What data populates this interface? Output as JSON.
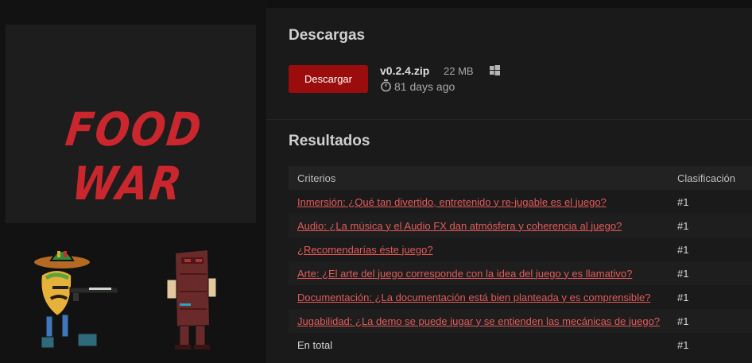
{
  "cover": {
    "title": "FOOD WAR"
  },
  "downloads": {
    "heading": "Descargas",
    "button_label": "Descargar",
    "file": {
      "name": "v0.2.4.zip",
      "size": "22 MB",
      "platform_icon": "windows-icon",
      "age": "81 days ago"
    }
  },
  "results": {
    "heading": "Resultados",
    "columns": [
      "Criterios",
      "Clasificación"
    ],
    "rows": [
      {
        "criterion": "Inmersión: ¿Qué tan divertido, entretenido y re-jugable es el juego?",
        "rank": "#1"
      },
      {
        "criterion": "Audio: ¿La música y el Audio FX dan atmósfera y coherencia al juego?",
        "rank": "#1"
      },
      {
        "criterion": "¿Recomendarías éste juego?",
        "rank": "#1"
      },
      {
        "criterion": "Arte: ¿El arte del juego corresponde con la idea del juego y es llamativo?",
        "rank": "#1"
      },
      {
        "criterion": "Documentación: ¿La documentación está bien planteada y es comprensible?",
        "rank": "#1"
      },
      {
        "criterion": "Jugabilidad: ¿La demo se puede jugar y se entienden las mecánicas de juego?",
        "rank": "#1"
      }
    ],
    "total": {
      "label": "En total",
      "rank": "#1"
    }
  },
  "colors": {
    "accent": "#9b0d0d",
    "link": "#e35a5a",
    "cover_title": "#c9262e"
  }
}
